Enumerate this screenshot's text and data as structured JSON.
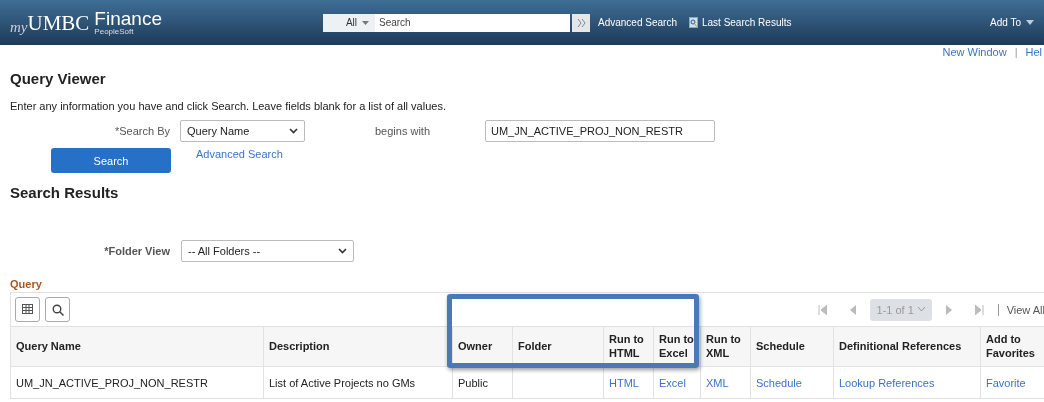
{
  "header": {
    "logo": {
      "prefix": "my",
      "name": "UMBC",
      "product": "Finance",
      "sub": "PeopleSoft"
    },
    "search": {
      "scope": "All",
      "placeholder": "Search"
    },
    "advanced_link": "Advanced Search",
    "last_results": "Last Search Results",
    "add_to": "Add To"
  },
  "top_links": [
    "New Window",
    "|",
    "Hel"
  ],
  "title": "Query Viewer",
  "instructions": "Enter any information you have and click Search. Leave fields blank for a list of all values.",
  "search_by": {
    "label": "*Search By",
    "value": "Query Name",
    "operator": "begins with",
    "text": "UM_JN_ACTIVE_PROJ_NON_RESTR"
  },
  "search_button": "Search",
  "advanced_search": "Advanced Search",
  "results_title": "Search Results",
  "folder_view": {
    "label": "*Folder View",
    "value": "-- All Folders --"
  },
  "grid": {
    "title": "Query",
    "pager": {
      "range": "1-1 of 1",
      "view_all": "View All",
      "disabled": true
    },
    "columns": [
      {
        "line1": "Query Name"
      },
      {
        "line1": "Description"
      },
      {
        "line1": "Owner"
      },
      {
        "line1": "Folder"
      },
      {
        "line1": "Run to",
        "line2": "HTML"
      },
      {
        "line1": "Run to",
        "line2": "Excel"
      },
      {
        "line1": "Run to",
        "line2": "XML"
      },
      {
        "line1": "Schedule"
      },
      {
        "line1": "Definitional References"
      },
      {
        "line1": "Add to",
        "line2": "Favorites"
      }
    ],
    "rows": [
      {
        "cells": [
          {
            "text": "UM_JN_ACTIVE_PROJ_NON_RESTR",
            "kind": "text"
          },
          {
            "text": "List of Active Projects no GMs",
            "kind": "text"
          },
          {
            "text": "Public",
            "kind": "text"
          },
          {
            "text": "",
            "kind": "text"
          },
          {
            "text": "HTML",
            "kind": "link"
          },
          {
            "text": "Excel",
            "kind": "link"
          },
          {
            "text": "XML",
            "kind": "link"
          },
          {
            "text": "Schedule",
            "kind": "link"
          },
          {
            "text": "Lookup References",
            "kind": "link"
          },
          {
            "text": "Favorite",
            "kind": "link"
          }
        ]
      }
    ]
  }
}
